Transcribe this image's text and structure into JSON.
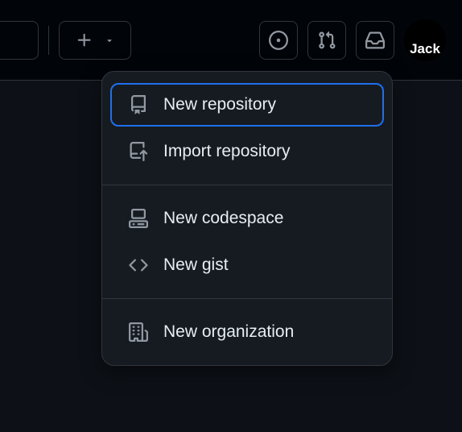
{
  "avatar": {
    "label": "Jack"
  },
  "dropdown": {
    "groups": [
      {
        "items": [
          {
            "label": "New repository",
            "highlighted": true,
            "icon": "repo-icon"
          },
          {
            "label": "Import repository",
            "highlighted": false,
            "icon": "repo-push-icon"
          }
        ]
      },
      {
        "items": [
          {
            "label": "New codespace",
            "highlighted": false,
            "icon": "codespaces-icon"
          },
          {
            "label": "New gist",
            "highlighted": false,
            "icon": "code-icon"
          }
        ]
      },
      {
        "items": [
          {
            "label": "New organization",
            "highlighted": false,
            "icon": "organization-icon"
          }
        ]
      }
    ]
  }
}
